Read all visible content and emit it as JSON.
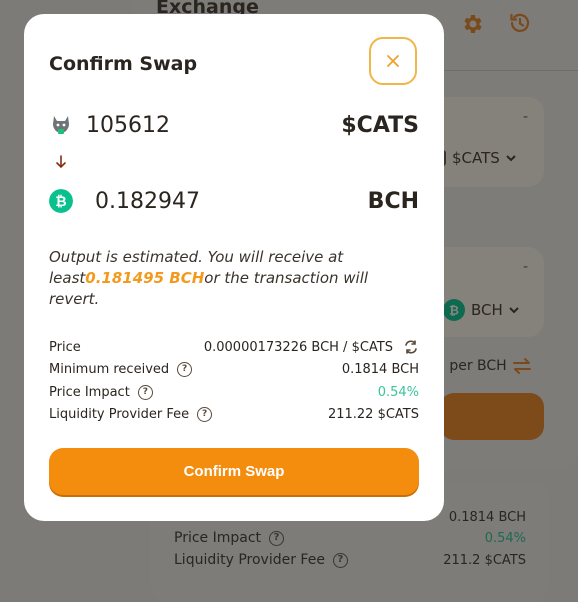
{
  "background": {
    "title": "Exchange",
    "top_token_dash": "-",
    "top_token_symbol": "$CATS",
    "bottom_token_dash": "-",
    "bottom_token_symbol": "BCH",
    "rate_text": "S per BCH",
    "details": {
      "min_received_value": "0.1814 BCH",
      "price_impact_label": "Price Impact",
      "price_impact_value": "0.54%",
      "lp_fee_label": "Liquidity Provider Fee",
      "lp_fee_value": "211.2 $CATS"
    }
  },
  "modal": {
    "title": "Confirm Swap",
    "input": {
      "amount": "105612",
      "symbol": "$CATS"
    },
    "output": {
      "amount": "0.182947",
      "symbol": "BCH"
    },
    "estimate": {
      "prefix": "Output is estimated. You will receive at least",
      "highlight": "0.181495 BCH",
      "suffix": "or the transaction will revert."
    },
    "details": {
      "price_label": "Price",
      "price_value": "0.00000173226 BCH / $CATS",
      "min_received_label": "Minimum received",
      "min_received_value": "0.1814 BCH",
      "price_impact_label": "Price Impact",
      "price_impact_value": "0.54%",
      "lp_fee_label": "Liquidity Provider Fee",
      "lp_fee_value": "211.22 $CATS"
    },
    "confirm_label": "Confirm Swap"
  },
  "colors": {
    "accent": "#f48c0e",
    "positive": "#3bc49a",
    "bch": "#0ac18e"
  }
}
